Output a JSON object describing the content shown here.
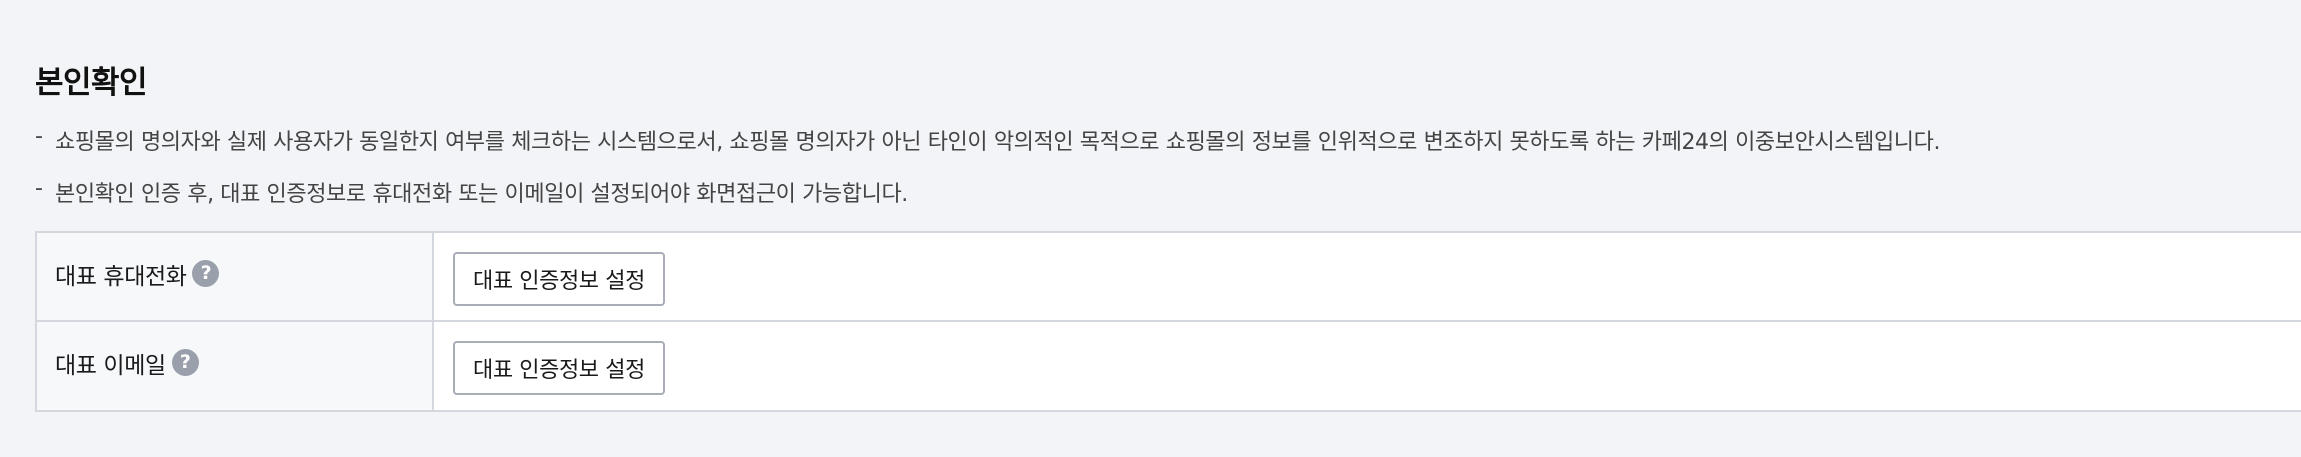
{
  "section": {
    "title": "본인확인",
    "descriptions": [
      "쇼핑몰의 명의자와 실제 사용자가 동일한지 여부를 체크하는 시스템으로서, 쇼핑몰 명의자가 아닌 타인이 악의적인 목적으로 쇼핑몰의 정보를 인위적으로 변조하지 못하도록 하는 카페24의 이중보안시스템입니다.",
      "본인확인 인증 후, 대표 인증정보로 휴대전화 또는 이메일이 설정되어야 화면접근이 가능합니다."
    ],
    "bullet": "-"
  },
  "table": {
    "rows": [
      {
        "label": "대표 휴대전화",
        "help_icon": "question-circle-icon",
        "help_glyph": "?",
        "button_label": "대표 인증정보 설정"
      },
      {
        "label": "대표 이메일",
        "help_icon": "question-circle-icon",
        "help_glyph": "?",
        "button_label": "대표 인증정보 설정"
      }
    ]
  },
  "colors": {
    "background": "#f3f4f8",
    "border": "#d5d7de",
    "header_cell": "#f7f8fa",
    "help_icon": "#9aa0ab",
    "button_border": "#a8adb8"
  }
}
